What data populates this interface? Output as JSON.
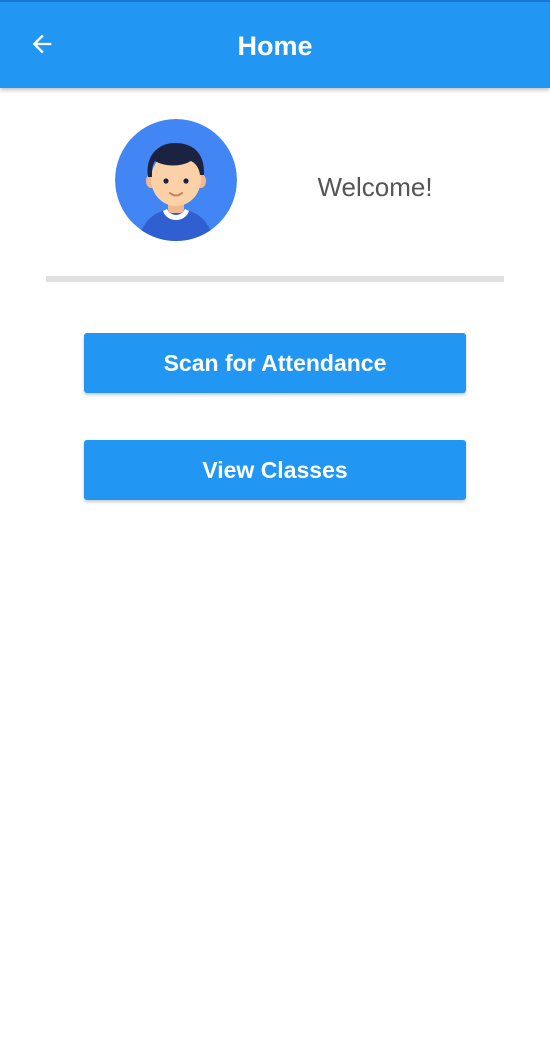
{
  "app_bar": {
    "title": "Home",
    "back_icon": "arrow-left-icon",
    "color": "#2196f3"
  },
  "profile": {
    "avatar_icon": "user-avatar-icon",
    "avatar_bg": "#4285f4",
    "welcome_text": "Welcome!"
  },
  "actions": {
    "scan_label": "Scan for Attendance",
    "classes_label": "View Classes",
    "button_color": "#2196f3"
  }
}
